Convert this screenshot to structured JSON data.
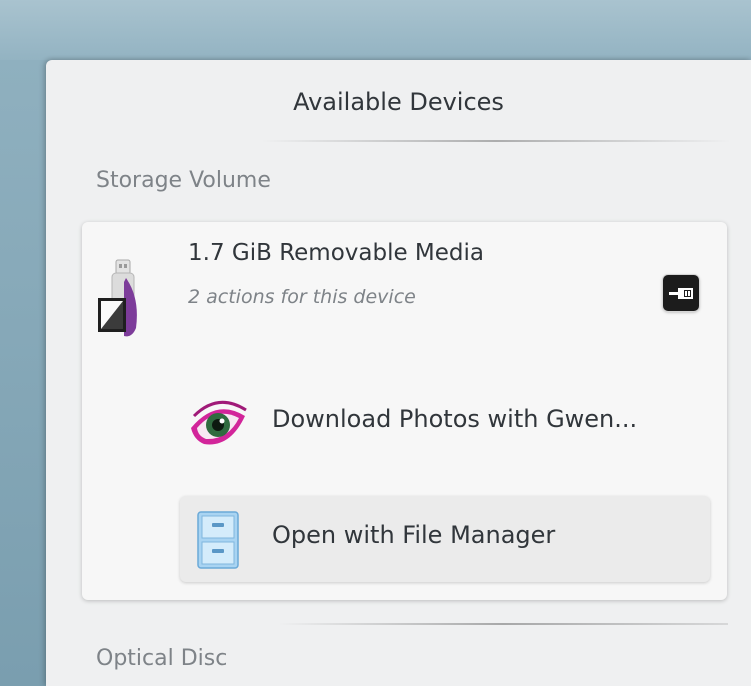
{
  "popup": {
    "title": "Available Devices",
    "sections": [
      {
        "header": "Storage Volume",
        "devices": [
          {
            "name": "1.7 GiB Removable Media",
            "subtitle": "2 actions for this device",
            "icon": "usb-drive-icon",
            "eject_icon": "eject-icon",
            "actions": [
              {
                "label": "Download Photos with Gwen...",
                "icon": "gwenview-eye-icon"
              },
              {
                "label": "Open with File Manager",
                "icon": "file-manager-cabinet-icon"
              }
            ]
          }
        ]
      },
      {
        "header": "Optical Disc"
      }
    ]
  },
  "colors": {
    "popup_background": "#eff0f1",
    "card_background": "#f7f7f7",
    "text": "#31363b",
    "muted_text": "#7e8388",
    "desktop": "#8fb0bf"
  }
}
